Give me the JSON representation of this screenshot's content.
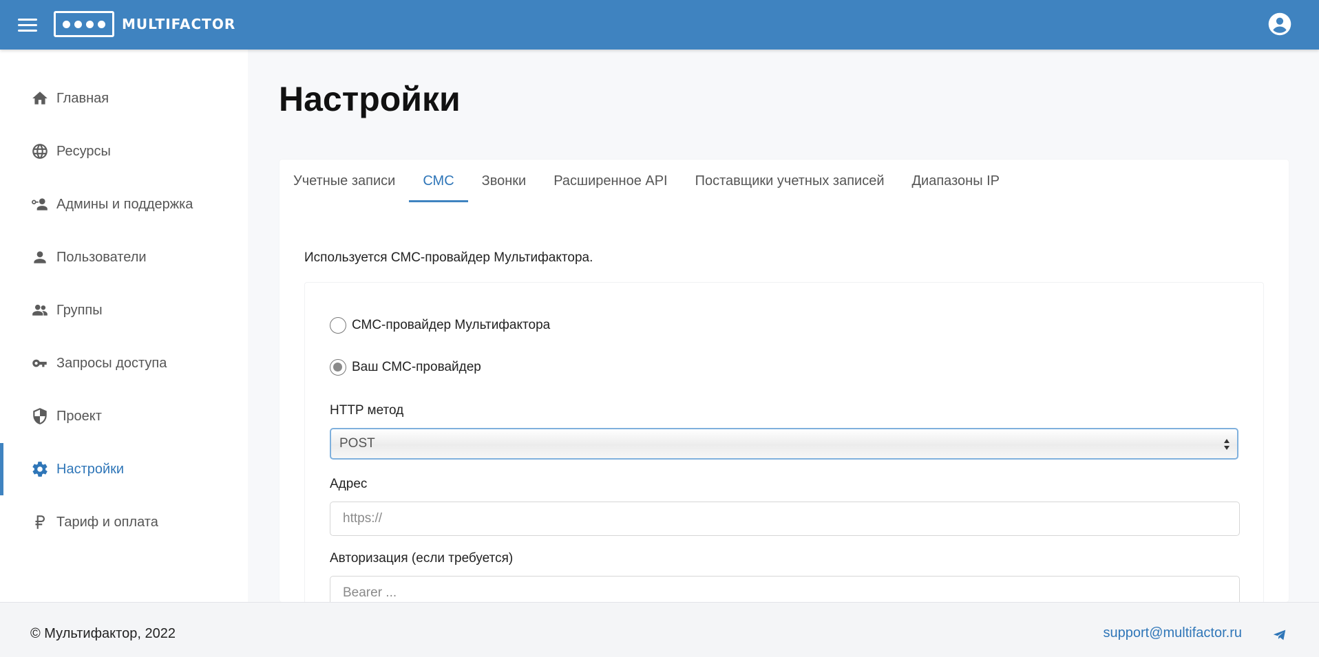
{
  "header": {
    "brand": "MULTIFACTOR",
    "accent_color": "#3f83c0",
    "icons": {
      "menu": "hamburger-menu-icon",
      "account": "account-circle-icon"
    }
  },
  "sidebar": {
    "items": [
      {
        "label": "Главная",
        "icon": "home-icon",
        "active": false
      },
      {
        "label": "Ресурсы",
        "icon": "globe-icon",
        "active": false
      },
      {
        "label": "Админы и поддержка",
        "icon": "admin-support-icon",
        "active": false
      },
      {
        "label": "Пользователи",
        "icon": "person-icon",
        "active": false
      },
      {
        "label": "Группы",
        "icon": "group-icon",
        "active": false
      },
      {
        "label": "Запросы доступа",
        "icon": "key-icon",
        "active": false
      },
      {
        "label": "Проект",
        "icon": "shield-icon",
        "active": false
      },
      {
        "label": "Настройки",
        "icon": "gear-icon",
        "active": true
      },
      {
        "label": "Тариф и оплата",
        "icon": "ruble-icon",
        "active": false
      }
    ]
  },
  "main": {
    "title": "Настройки",
    "tabs": [
      {
        "label": "Учетные записи",
        "active": false
      },
      {
        "label": "СМС",
        "active": true
      },
      {
        "label": "Звонки",
        "active": false
      },
      {
        "label": "Расширенное API",
        "active": false
      },
      {
        "label": "Поставщики учетных записей",
        "active": false
      },
      {
        "label": "Диапазоны IP",
        "active": false
      }
    ],
    "info_text": "Используется СМС-провайдер Мультифактора.",
    "provider_options": [
      {
        "label": "СМС-провайдер Мультифактора",
        "checked": false
      },
      {
        "label": "Ваш СМС-провайдер",
        "checked": true
      }
    ],
    "http_method": {
      "label": "HTTP метод",
      "value": "POST"
    },
    "address": {
      "label": "Адрес",
      "value": "",
      "placeholder": "https://"
    },
    "authorization": {
      "label": "Авторизация (если требуется)",
      "value": "",
      "placeholder": "Bearer ..."
    }
  },
  "footer": {
    "copyright": "© Мультифактор, 2022",
    "support_email": "support@multifactor.ru",
    "icon": "telegram-icon"
  }
}
